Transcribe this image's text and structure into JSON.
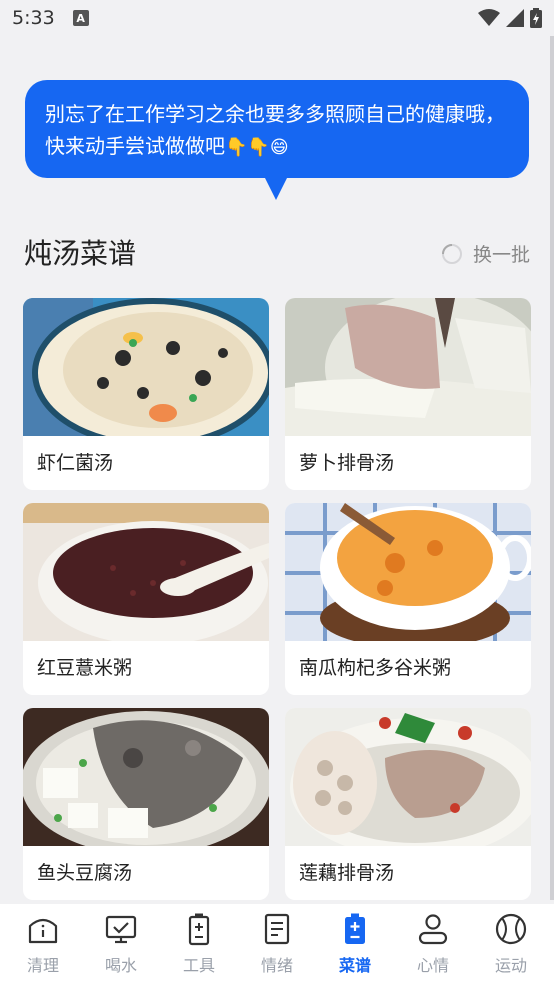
{
  "status_bar": {
    "time": "5:33",
    "notif_icon": "A"
  },
  "bubble": {
    "text": "别忘了在工作学习之余也要多多照顾自己的健康哦，快来动手尝试做做吧",
    "emojis": [
      "👇",
      "👇",
      "😄"
    ]
  },
  "section": {
    "title": "炖汤菜谱",
    "refresh_label": "换一批"
  },
  "recipes": [
    {
      "name": "虾仁菌汤"
    },
    {
      "name": "萝卜排骨汤"
    },
    {
      "name": "红豆薏米粥"
    },
    {
      "name": "南瓜枸杞多谷米粥"
    },
    {
      "name": "鱼头豆腐汤"
    },
    {
      "name": "莲藕排骨汤"
    }
  ],
  "nav": {
    "items": [
      {
        "label": "清理",
        "icon": "home-info-icon"
      },
      {
        "label": "喝水",
        "icon": "monitor-check-icon"
      },
      {
        "label": "工具",
        "icon": "battery-plus-icon"
      },
      {
        "label": "情绪",
        "icon": "document-icon"
      },
      {
        "label": "菜谱",
        "icon": "battery-plus-filled-icon"
      },
      {
        "label": "心情",
        "icon": "person-icon"
      },
      {
        "label": "运动",
        "icon": "baseball-icon"
      }
    ],
    "active_index": 4
  },
  "colors": {
    "accent": "#1667f2",
    "inactive": "#9aa0aa",
    "background": "#f1f1f3"
  }
}
